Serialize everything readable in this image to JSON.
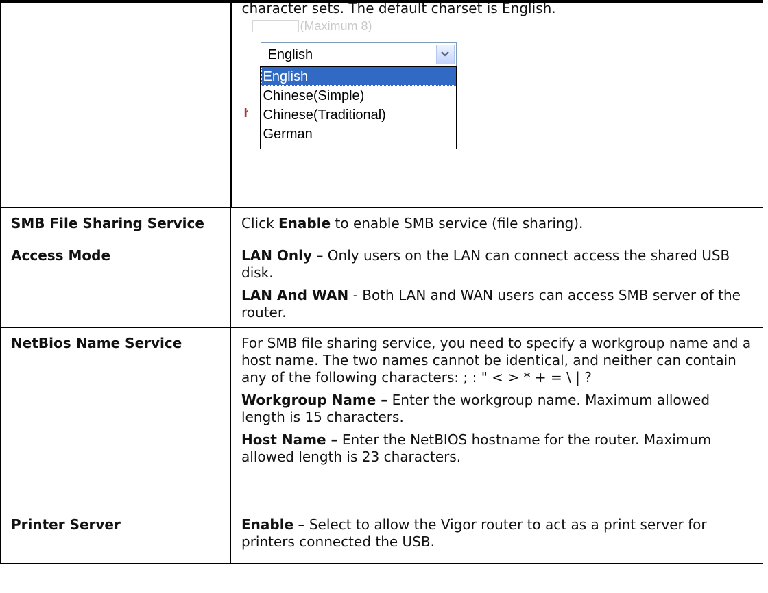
{
  "intro_line": "character sets. The default charset is English.",
  "charset_widget": {
    "ghost_text": "(Maximum 8)",
    "selected": "English",
    "options": [
      "English",
      "Chinese(Simple)",
      "Chinese(Traditional)",
      "German"
    ]
  },
  "rows": {
    "smb": {
      "term": "SMB File Sharing Service",
      "pre": "Click ",
      "bold": "Enable",
      "post": " to enable SMB service (file sharing)."
    },
    "access": {
      "term": "Access Mode",
      "p1_bold": "LAN Only",
      "p1_text": " – Only users on the LAN can connect access the shared USB disk.",
      "p2_bold": "LAN And WAN",
      "p2_text": " - Both LAN and WAN users can access SMB server of the router."
    },
    "netbios": {
      "term": "NetBios Name Service",
      "p1_text": "For SMB file sharing service, you need to specify a workgroup name and a host name. The two names cannot be identical, and neither can contain any of the following characters: ; : \" < > * + = \\ | ?",
      "p2_bold": "Workgroup Name –",
      "p2_text": " Enter the workgroup name. Maximum allowed length is 15 characters.",
      "p3_bold": "Host Name –",
      "p3_text": " Enter the NetBIOS hostname for the router. Maximum allowed length is 23 characters."
    },
    "printer": {
      "term": "Printer Server",
      "p1_bold": "Enable",
      "p1_text": " – Select to allow the Vigor router to act as a print server for printers connected the USB."
    }
  },
  "colors": {
    "listbox_highlight": "#316ac5",
    "select_border": "#7f9db9"
  },
  "icons": {
    "dropdown_arrow": "chevron-down-icon"
  }
}
